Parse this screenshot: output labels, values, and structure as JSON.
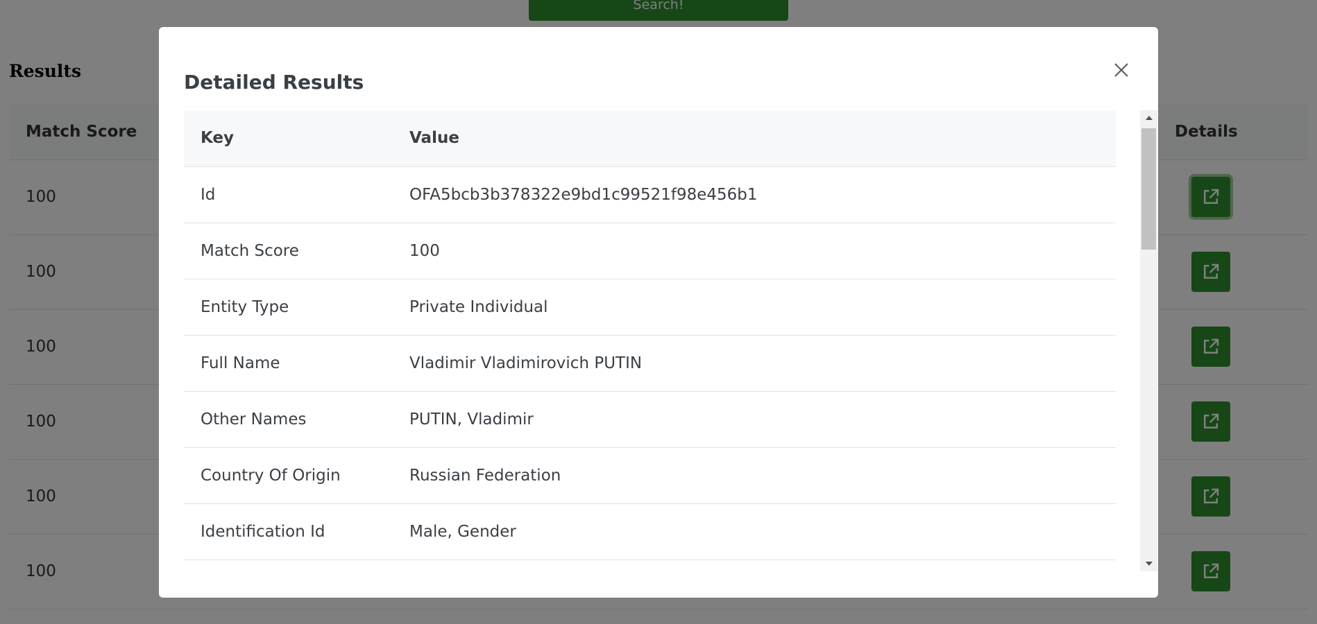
{
  "page": {
    "search_button_label": "Search!",
    "results_heading": "Results",
    "results_table": {
      "columns": [
        "Match Score",
        "Details"
      ],
      "rows": [
        {
          "match_score": "100"
        },
        {
          "match_score": "100"
        },
        {
          "match_score": "100"
        },
        {
          "match_score": "100"
        },
        {
          "match_score": "100"
        },
        {
          "match_score": "100"
        }
      ]
    },
    "details_icon": "external-link-icon"
  },
  "modal": {
    "title": "Detailed Results",
    "close_icon": "close-icon",
    "table": {
      "headers": {
        "key": "Key",
        "value": "Value"
      },
      "rows": [
        {
          "key": "Id",
          "value": "OFA5bcb3b378322e9bd1c99521f98e456b1"
        },
        {
          "key": "Match Score",
          "value": "100"
        },
        {
          "key": "Entity Type",
          "value": "Private Individual"
        },
        {
          "key": "Full Name",
          "value": "Vladimir Vladimirovich PUTIN"
        },
        {
          "key": "Other Names",
          "value": "PUTIN, Vladimir"
        },
        {
          "key": "Country Of Origin",
          "value": "Russian Federation"
        },
        {
          "key": "Identification Id",
          "value": "Male, Gender"
        }
      ]
    }
  },
  "colors": {
    "accent_green": "#2f8f2f",
    "backdrop": "rgba(0,0,0,0.5)",
    "header_bg": "#f7f8f9",
    "text": "#3a3f44"
  }
}
